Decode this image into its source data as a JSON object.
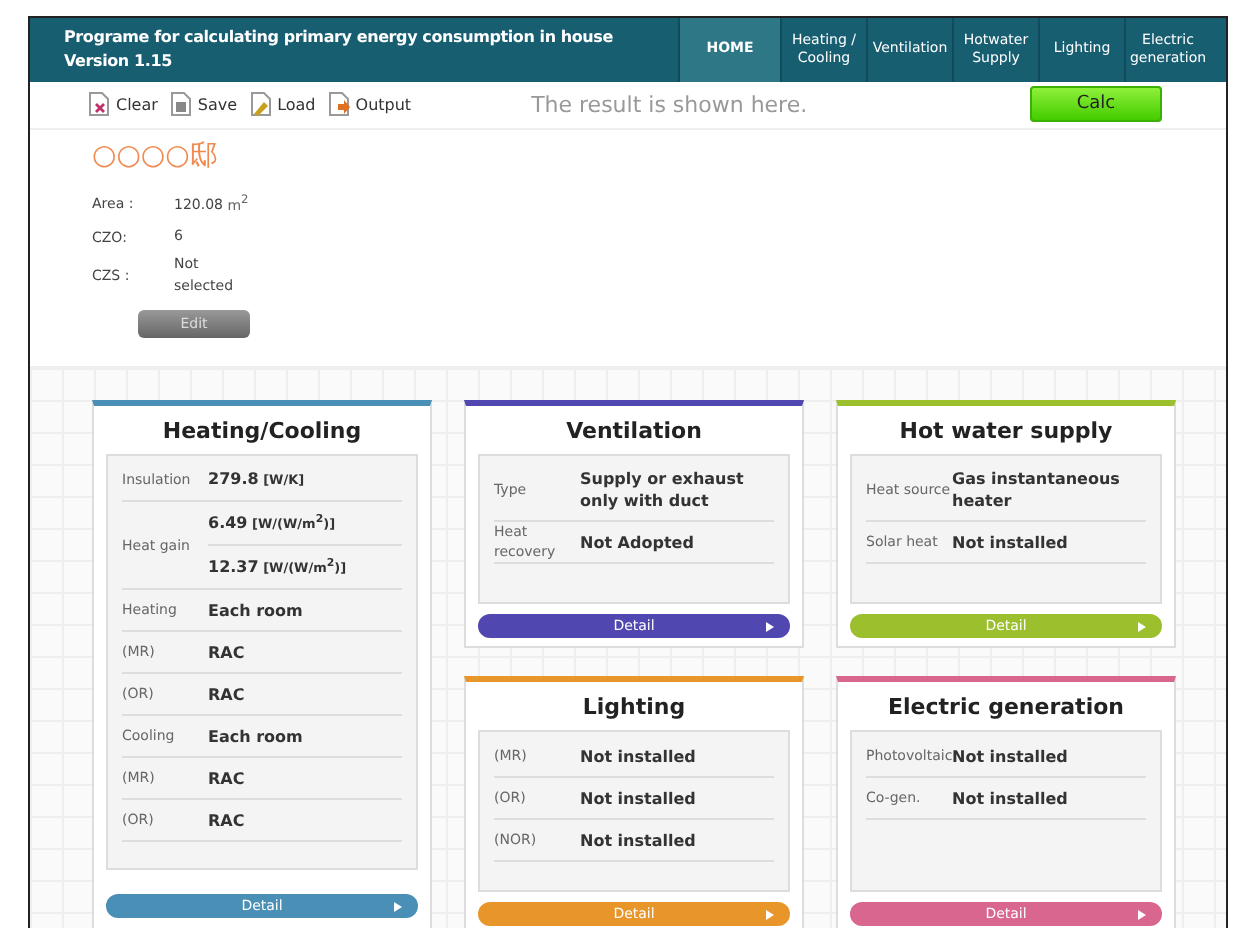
{
  "header": {
    "title": "Programe for calculating primary energy consumption in house",
    "version": "Version 1.15",
    "nav": [
      {
        "label": "HOME",
        "selected": true
      },
      {
        "label": "Heating / Cooling",
        "selected": false
      },
      {
        "label": "Ventilation",
        "selected": false
      },
      {
        "label": "Hotwater Supply",
        "selected": false
      },
      {
        "label": "Lighting",
        "selected": false
      },
      {
        "label": "Electric generation",
        "selected": false
      }
    ]
  },
  "toolbar": {
    "actions": [
      {
        "label": "Clear",
        "kind": "clear"
      },
      {
        "label": "Save",
        "kind": "save"
      },
      {
        "label": "Load",
        "kind": "load"
      },
      {
        "label": "Output",
        "kind": "output"
      }
    ],
    "result": "The result is shown here.",
    "calc": "Calc"
  },
  "house": {
    "name": "○○○○邸",
    "info": [
      {
        "label": "Area :",
        "value": "120.08",
        "unit": "m$^{2}$"
      },
      {
        "label": "CZO:",
        "value": "6"
      },
      {
        "label": "CZS :",
        "value": "Not selected"
      }
    ],
    "edit": "Edit"
  },
  "cards": [
    {
      "title": "Heating/Cooling",
      "color": "#4a8fb5",
      "detail": "Detail",
      "rows": [
        {
          "label": "Insulation",
          "values": [
            {
              "value": "279.8",
              "unit": "[W/K]"
            }
          ]
        },
        {
          "label": "Heat gain",
          "values": [
            {
              "value": "6.49",
              "unit": "[W/(W/m$^{2}$)]"
            },
            {
              "value": "12.37",
              "unit": "[W/(W/m$^{2}$)]"
            }
          ]
        },
        {
          "label": "Heating",
          "values": [
            {
              "value": "Each room"
            }
          ]
        },
        {
          "label": "(MR)",
          "values": [
            {
              "value": "RAC"
            }
          ]
        },
        {
          "label": "(OR)",
          "values": [
            {
              "value": "RAC"
            }
          ]
        },
        {
          "label": "Cooling",
          "values": [
            {
              "value": "Each room"
            }
          ]
        },
        {
          "label": "(MR)",
          "values": [
            {
              "value": "RAC"
            }
          ]
        },
        {
          "label": "(OR)",
          "values": [
            {
              "value": "RAC"
            }
          ]
        }
      ]
    },
    {
      "title": "Ventilation",
      "color": "#5048b0",
      "detail": "Detail",
      "rows": [
        {
          "label": "Type",
          "values": [
            {
              "value": "Supply or exhaust only with duct"
            }
          ]
        },
        {
          "label": "Heat recovery",
          "values": [
            {
              "value": "Not Adopted"
            }
          ]
        }
      ]
    },
    {
      "title": "Hot water supply",
      "color": "#9cbf2e",
      "detail": "Detail",
      "rows": [
        {
          "label": "Heat source",
          "values": [
            {
              "value": "Gas instantaneous heater"
            }
          ]
        },
        {
          "label": "Solar heat",
          "values": [
            {
              "value": "Not installed"
            }
          ]
        }
      ]
    },
    {
      "title": "Lighting",
      "color": "#e8962a",
      "detail": "Detail",
      "rows": [
        {
          "label": "(MR)",
          "values": [
            {
              "value": "Not installed"
            }
          ]
        },
        {
          "label": "(OR)",
          "values": [
            {
              "value": "Not installed"
            }
          ]
        },
        {
          "label": "(NOR)",
          "values": [
            {
              "value": "Not installed"
            }
          ]
        }
      ]
    },
    {
      "title": "Electric generation",
      "color": "#d8668e",
      "detail": "Detail",
      "rows": [
        {
          "label": "Photovoltaic",
          "values": [
            {
              "value": "Not installed"
            }
          ]
        },
        {
          "label": "Co-gen.",
          "values": [
            {
              "value": "Not installed"
            }
          ]
        }
      ]
    }
  ]
}
